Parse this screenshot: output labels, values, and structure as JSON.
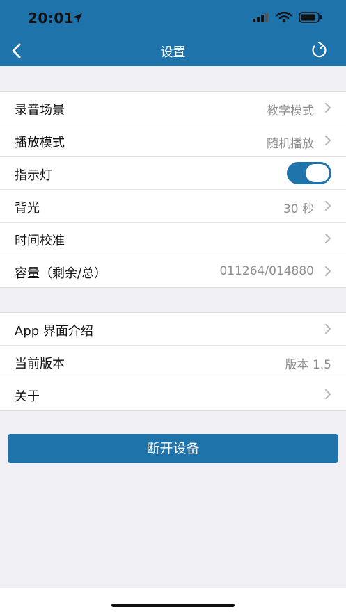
{
  "status_bar": {
    "time": "20:01"
  },
  "nav": {
    "title": "设置"
  },
  "group1": {
    "rows": [
      {
        "label": "录音场景",
        "value": "教学模式"
      },
      {
        "label": "播放模式",
        "value": "随机播放"
      },
      {
        "label": "指示灯",
        "toggle": true
      },
      {
        "label": "背光",
        "value": "30 秒"
      },
      {
        "label": "时间校准",
        "value": ""
      },
      {
        "label": "容量（剩余/总）",
        "value": "011264/014880"
      }
    ]
  },
  "group2": {
    "rows": [
      {
        "label": "App 界面介绍",
        "value": ""
      },
      {
        "label": "当前版本",
        "value": "版本 1.5"
      },
      {
        "label": "关于",
        "value": ""
      }
    ]
  },
  "actions": {
    "disconnect_label": "断开设备"
  },
  "colors": {
    "header": "#1f73ab",
    "background": "#f0eff4",
    "toggle_on": "#1f73ab"
  },
  "icons": [
    "location-arrow-icon",
    "signal-icon",
    "wifi-icon",
    "battery-icon",
    "back-chevron-icon",
    "refresh-icon",
    "chevron-right-icon"
  ]
}
